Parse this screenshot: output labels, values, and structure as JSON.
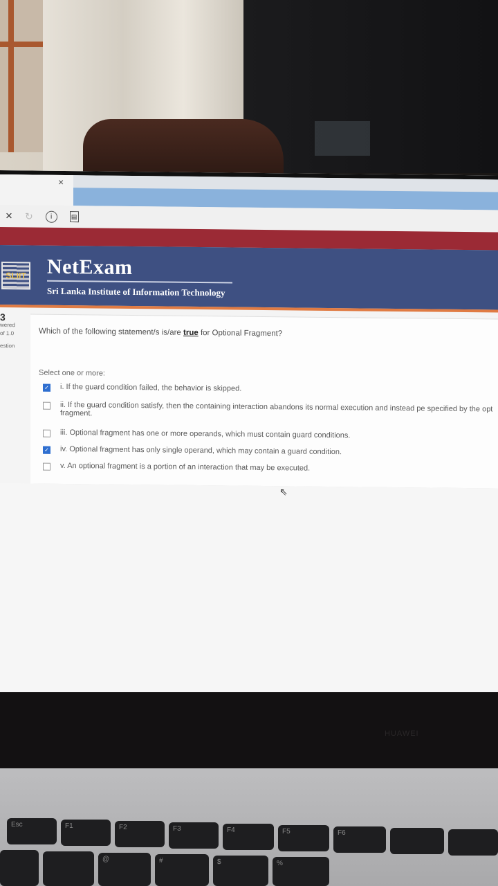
{
  "browser": {
    "tab_close": "×",
    "nav_close": "×",
    "nav_reload": "↻",
    "nav_info": "i",
    "nav_page": "▤"
  },
  "header": {
    "logo_text": "SLIIT",
    "brand": "NetExam",
    "subtitle": "Sri Lanka Institute of Information Technology"
  },
  "sidebar": {
    "question_number": "3",
    "status": "wered",
    "marks": "of 1.0",
    "flag": "estion"
  },
  "quiz": {
    "question_before": "Which of the following statement/s is/are ",
    "question_emphasis": "true",
    "question_after": " for Optional Fragment?",
    "prompt": "Select one or more:",
    "options": [
      {
        "text": "i. If the guard condition failed, the behavior is skipped.",
        "checked": true
      },
      {
        "text": "ii. If the guard condition satisfy, then the containing interaction abandons its normal execution and instead pe specified by the opt fragment.",
        "checked": false
      },
      {
        "text": "iii. Optional fragment has one or more operands, which must contain guard conditions.",
        "checked": false
      },
      {
        "text": "iv. Optional fragment has only single operand, which may contain a guard condition.",
        "checked": true
      },
      {
        "text": "v. An optional fragment is a portion of an interaction that may be executed.",
        "checked": false
      }
    ],
    "check_glyph": "✓"
  },
  "device": {
    "bezel_brand": "HUAWEI",
    "keys": [
      "Esc",
      "F1",
      "F2",
      "F3",
      "F4",
      "F5",
      "F6",
      "@",
      "#",
      "$",
      "%"
    ]
  },
  "colors": {
    "header_bg": "#3e5082",
    "accent_red": "#9b2a35",
    "accent_orange": "#e07b43",
    "checkbox_checked": "#2f6fd0"
  }
}
